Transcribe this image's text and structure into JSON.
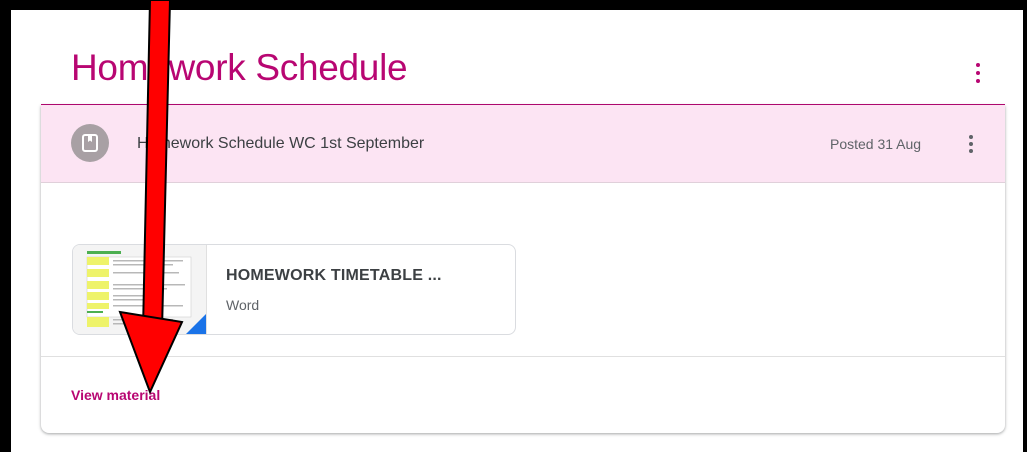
{
  "topic": {
    "title": "Homework Schedule",
    "menu_icon": "more-vert-icon",
    "accent_color": "#b80672"
  },
  "material": {
    "icon": "book-icon",
    "title": "Homework Schedule WC 1st September",
    "posted": "Posted 31 Aug",
    "menu_icon": "more-vert-icon",
    "header_color": "#fce4f3"
  },
  "attachment": {
    "title": "HOMEWORK TIMETABLE ...",
    "type": "Word",
    "file_icon": "word-file-icon"
  },
  "footer": {
    "view_label": "View material"
  },
  "annotation": {
    "icon": "arrow-down-icon",
    "color": "#ff0000"
  }
}
